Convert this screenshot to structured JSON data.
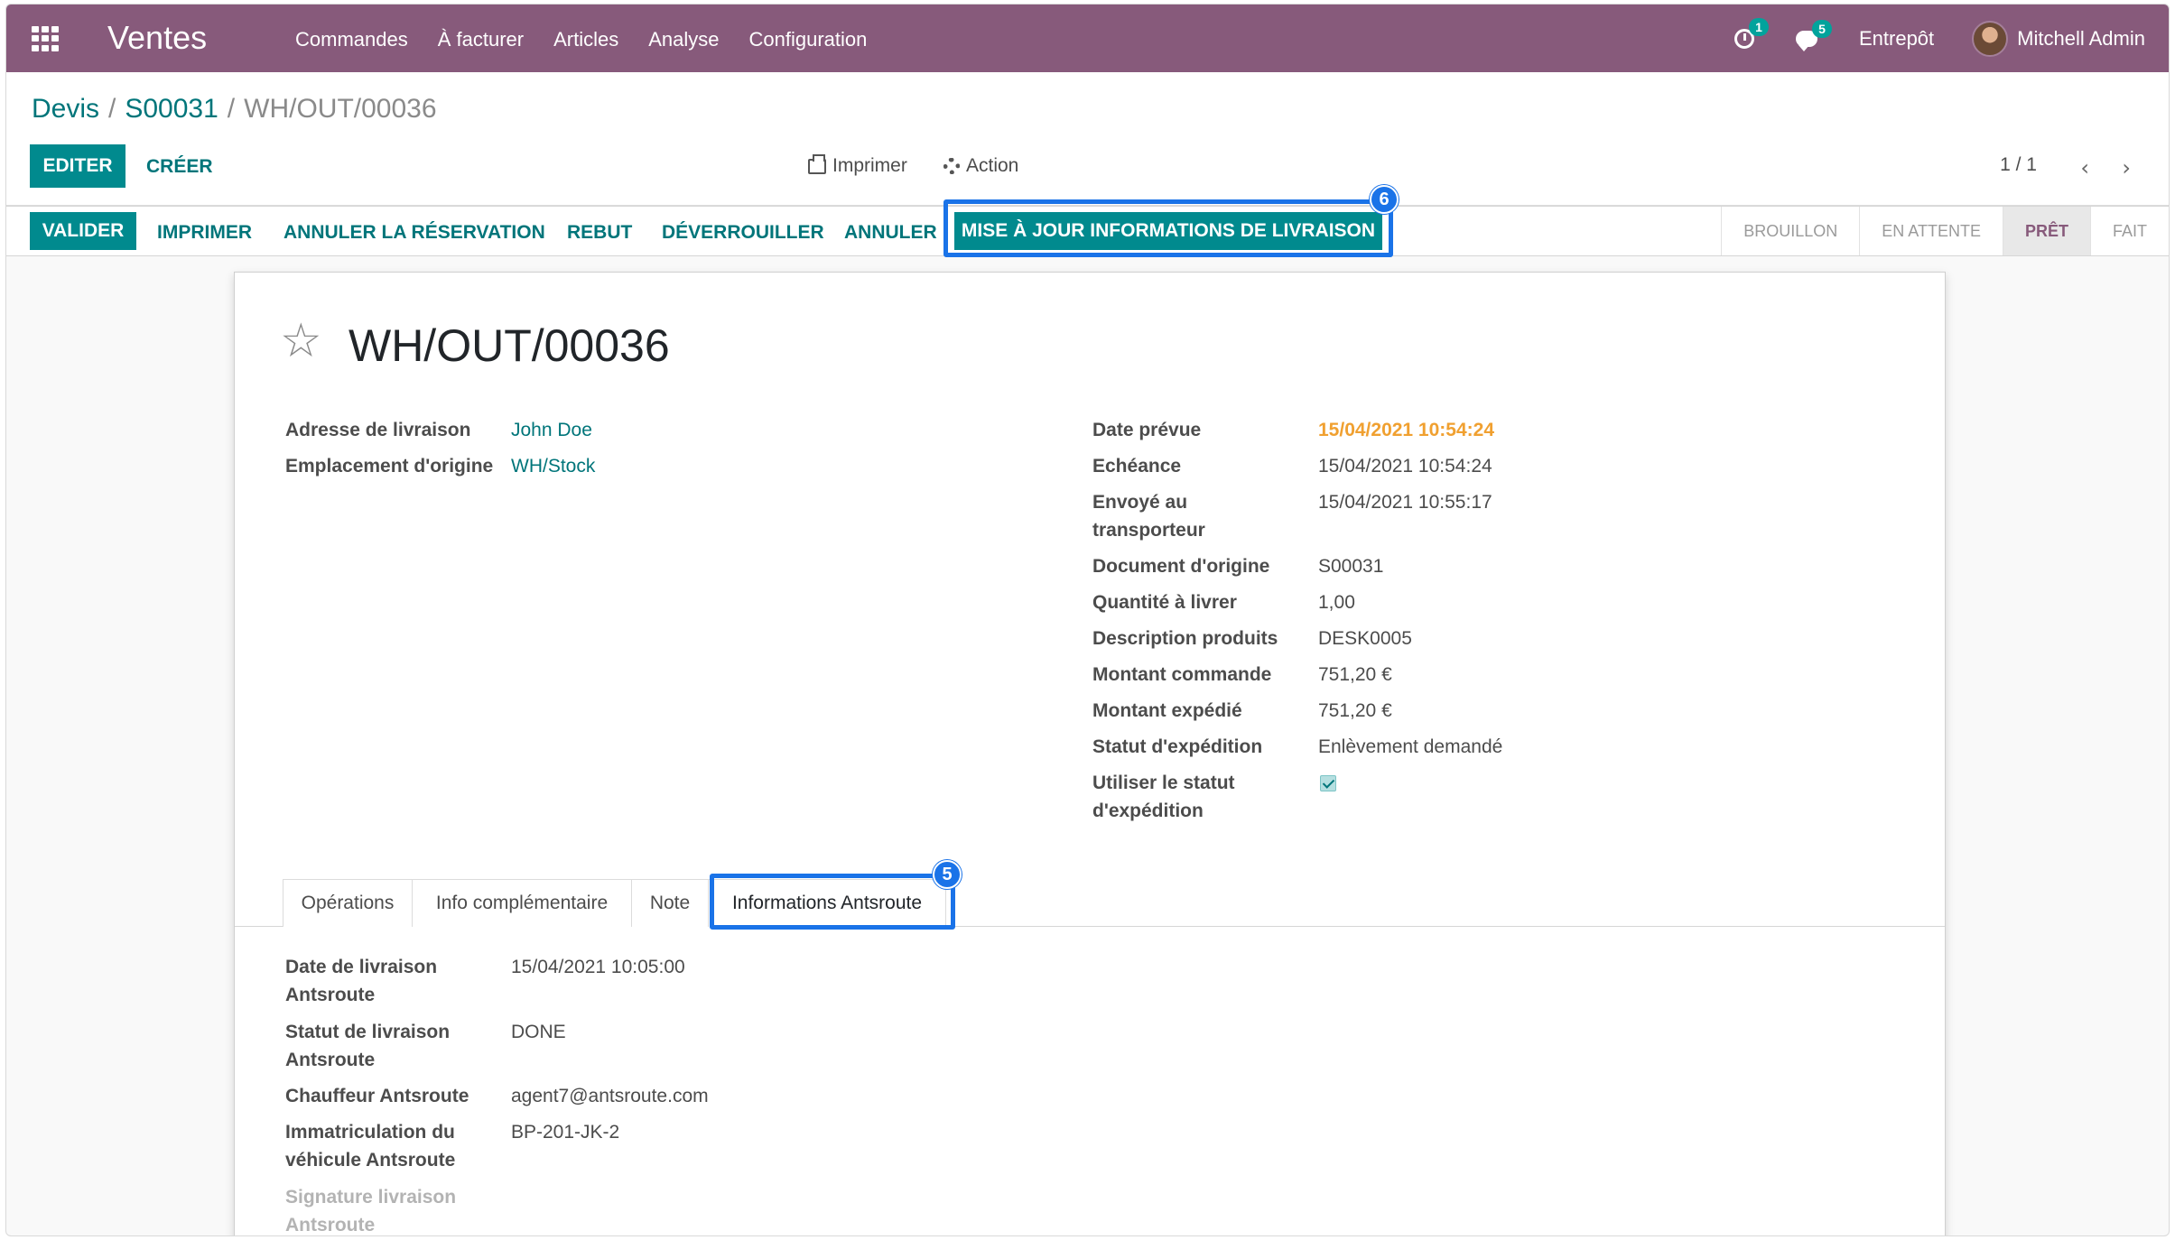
{
  "navbar": {
    "app_title": "Ventes",
    "menu": [
      "Commandes",
      "À facturer",
      "Articles",
      "Analyse",
      "Configuration"
    ],
    "activity_count": "1",
    "message_count": "5",
    "company": "Entrepôt",
    "user": "Mitchell Admin"
  },
  "breadcrumb": {
    "first": "Devis",
    "second": "S00031",
    "current": "WH/OUT/00036",
    "separator": "/"
  },
  "control": {
    "edit": "EDITER",
    "create": "CRÉER",
    "print": "Imprimer",
    "action": "Action",
    "pager": "1 / 1"
  },
  "status_buttons": {
    "validate": "VALIDER",
    "print": "IMPRIMER",
    "unreserve": "ANNULER LA RÉSERVATION",
    "scrap": "REBUT",
    "unlock": "DÉVERROUILLER",
    "cancel": "ANNULER",
    "update_delivery": "MISE À JOUR INFORMATIONS DE LIVRAISON"
  },
  "status_steps": [
    "BROUILLON",
    "EN ATTENTE",
    "PRÊT",
    "FAIT"
  ],
  "active_step": "PRÊT",
  "record": {
    "title": "WH/OUT/00036",
    "left_fields": [
      {
        "label": "Adresse de livraison",
        "value": "John Doe"
      },
      {
        "label": "Emplacement d'origine",
        "value": "WH/Stock"
      }
    ],
    "right_fields": {
      "scheduled_label": "Date prévue",
      "scheduled_value": "15/04/2021 10:54:24",
      "deadline_label": "Echéance",
      "deadline_value": "15/04/2021 10:54:24",
      "sent_label_1": "Envoyé au",
      "sent_label_2": "transporteur",
      "sent_value": "15/04/2021 10:55:17",
      "origin_label": "Document d'origine",
      "origin_value": "S00031",
      "qty_label": "Quantité à livrer",
      "qty_value": "1,00",
      "desc_label": "Description produits",
      "desc_value": "DESK0005",
      "amount_label": "Montant commande",
      "amount_value": "751,20 €",
      "shipped_label": "Montant expédié",
      "shipped_value": "751,20 €",
      "ship_status_label": "Statut d'expédition",
      "ship_status_value": "Enlèvement demandé",
      "use_status_label_1": "Utiliser le statut",
      "use_status_label_2": "d'expédition",
      "use_status_checked": true
    }
  },
  "tabs": [
    "Opérations",
    "Info complémentaire",
    "Note",
    "Informations Antsroute"
  ],
  "active_tab": "Informations Antsroute",
  "antsroute": {
    "delivery_date_label_1": "Date de livraison",
    "delivery_date_label_2": "Antsroute",
    "delivery_date_value": "15/04/2021 10:05:00",
    "delivery_status_label_1": "Statut de livraison",
    "delivery_status_label_2": "Antsroute",
    "delivery_status_value": "DONE",
    "driver_label": "Chauffeur Antsroute",
    "driver_value": "agent7@antsroute.com",
    "plate_label_1": "Immatriculation du",
    "plate_label_2": "véhicule Antsroute",
    "plate_value": "BP-201-JK-2",
    "signature_label_1": "Signature livraison",
    "signature_label_2": "Antsroute"
  },
  "callouts": {
    "update_button": "6",
    "antsroute_tab": "5"
  },
  "colors": {
    "primary": "#875a7b",
    "accent": "#018a8e",
    "highlight": "#1a73e8",
    "warning": "#f0a030"
  }
}
